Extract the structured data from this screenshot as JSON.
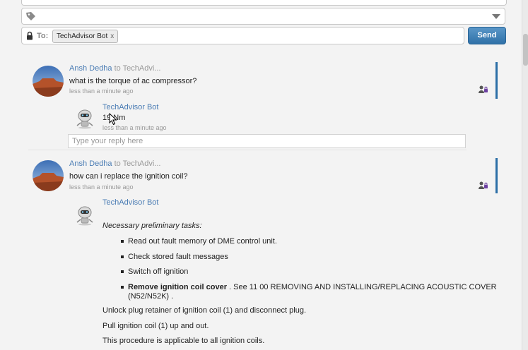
{
  "composer": {
    "to_label": "To:",
    "recipient": "TechAdvisor Bot",
    "recipient_remove": "x",
    "send_label": "Send"
  },
  "threads": [
    {
      "author": "Ansh Dedha",
      "to_text": "to TechAdvi...",
      "message": "what is the torque of ac compressor?",
      "time": "less than a minute ago",
      "reply": {
        "author": "TechAdvisor Bot",
        "message": "19 Nm",
        "time": "less than a minute ago"
      },
      "reply_placeholder": "Type your reply here"
    },
    {
      "author": "Ansh Dedha",
      "to_text": "to TechAdvi...",
      "message": "how can i replace the ignition coil?",
      "time": "less than a minute ago",
      "reply": {
        "author": "TechAdvisor Bot",
        "intro": "Necessary preliminary tasks:",
        "bullets": [
          "Read out fault memory of DME control unit.",
          "Check stored fault messages",
          "Switch off ignition"
        ],
        "bold_bullet": {
          "bold": "Remove ignition coil cover",
          "rest_line1": " . See 11 00 REMOVING AND INSTALLING/REPLACING ACOUSTIC COVER",
          "rest_line2": "(N52/N52K) ."
        },
        "paragraphs": [
          "Unlock plug retainer of ignition coil (1) and disconnect plug.",
          "Pull ignition coil (1) up and out.",
          "This procedure is applicable to all ignition coils."
        ]
      }
    }
  ],
  "icons": {
    "tag": "tag-icon",
    "dropdown": "chevron-down-icon",
    "lock": "lock-icon",
    "share": "people-lock-icon",
    "user_avatar": "avatar",
    "bot_avatar": "robot-avatar"
  }
}
